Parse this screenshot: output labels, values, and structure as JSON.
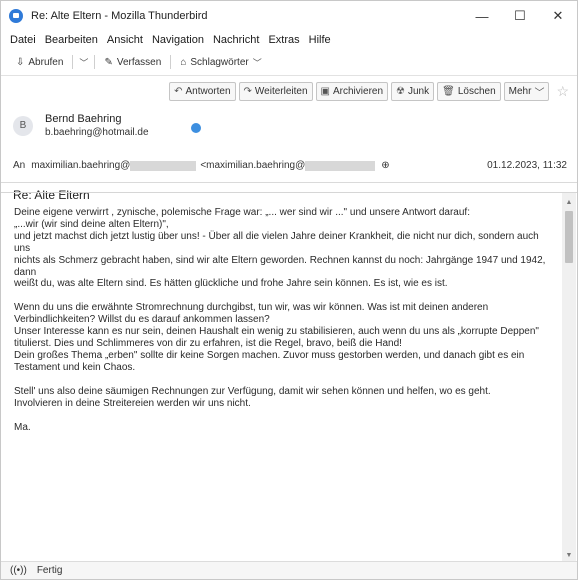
{
  "window": {
    "title": "Re: Alte Eltern - Mozilla Thunderbird",
    "controls": {
      "minimize": "—",
      "maximize": "☐",
      "close": "✕"
    }
  },
  "menubar": [
    "Datei",
    "Bearbeiten",
    "Ansicht",
    "Navigation",
    "Nachricht",
    "Extras",
    "Hilfe"
  ],
  "toolbar": {
    "get_mail": "Abrufen",
    "compose": "Verfassen",
    "tags": "Schlagwörter"
  },
  "actions": {
    "reply": "Antworten",
    "forward": "Weiterleiten",
    "archive": "Archivieren",
    "junk": "Junk",
    "delete": "Löschen",
    "more": "Mehr"
  },
  "message": {
    "sender_initial": "B",
    "sender_name": "Bernd Baehring",
    "sender_email": "b.baehring@hotmail.de",
    "to_label": "An",
    "to_part1": "maximilian.baehring@",
    "to_part2": "<maximilian.baehring@",
    "date": "01.12.2023, 11:32",
    "subject": "Re: Alte Eltern"
  },
  "body": [
    "Deine eigene verwirrt , zynische, polemische Frage war: „... wer sind wir ...\" und unsere Antwort darauf:\n„...wir (wir sind deine alten Eltern)\",\nund jetzt machst dich jetzt lustig über uns! - Über all die vielen Jahre deiner Krankheit, die nicht nur dich, sondern auch uns\nnichts als Schmerz gebracht haben, sind wir alte Eltern geworden. Rechnen kannst du noch: Jahrgänge 1947 und 1942, dann\nweißt du, was alte Eltern sind. Es hätten glückliche und frohe Jahre sein können. Es ist, wie es ist.",
    "Wenn du uns die erwähnte Stromrechnung durchgibst, tun wir, was wir können. Was ist mit deinen anderen\nVerbindlichkeiten? Willst du es darauf ankommen lassen?\nUnser Interesse kann es nur sein, deinen Haushalt ein wenig zu stabilisieren, auch wenn du uns als „korrupte Deppen\"\ntitulierst. Dies und Schlimmeres von dir zu erfahren, ist die Regel, bravo, beiß die Hand!\nDein großes Thema „erben\" sollte dir keine Sorgen machen. Zuvor muss gestorben werden, und danach gibt es ein\nTestament und kein Chaos.",
    "Stell' uns also deine säumigen Rechnungen zur Verfügung, damit wir sehen können und helfen, wo es geht.\nInvolvieren in deine Streitereien werden wir uns nicht.",
    "Ma."
  ],
  "status": {
    "text": "Fertig"
  }
}
